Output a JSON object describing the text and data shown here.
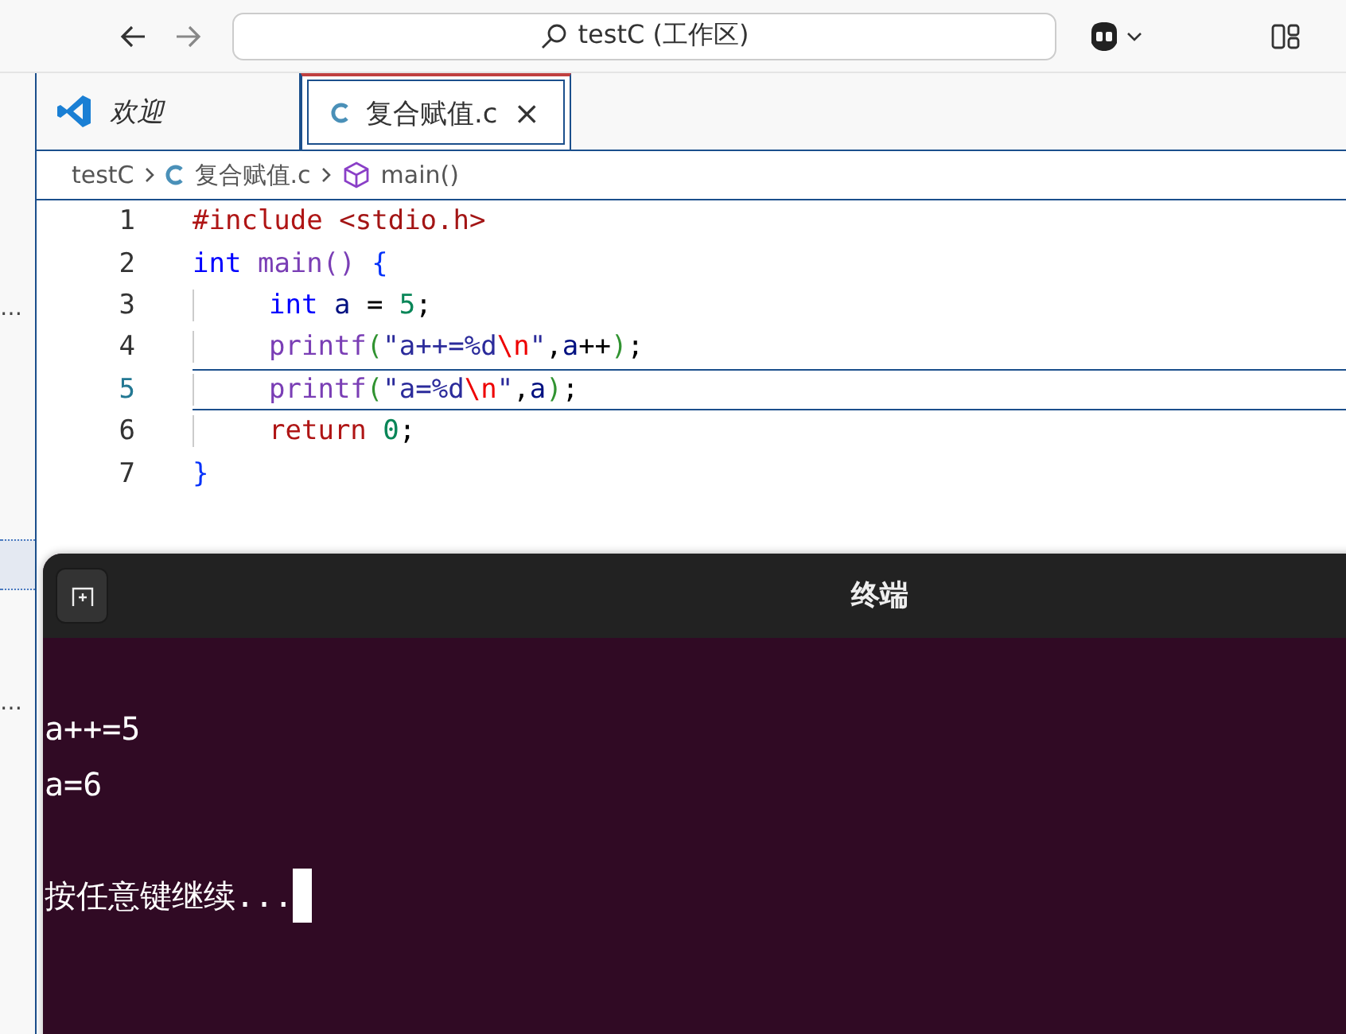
{
  "title_bar": {
    "search": "testC (工作区)"
  },
  "sidebar": {
    "items": [
      "…",
      "…"
    ]
  },
  "tabs": [
    {
      "label": "欢迎",
      "kind": "welcome",
      "selected": false
    },
    {
      "label": "复合赋值.c",
      "kind": "c",
      "selected": true,
      "close": "×"
    }
  ],
  "breadcrumb": [
    {
      "label": "testC",
      "kind": "folder"
    },
    {
      "label": "复合赋值.c",
      "kind": "c"
    },
    {
      "label": "main()",
      "kind": "symbol"
    }
  ],
  "code": [
    {
      "number": "1",
      "current": false,
      "indent": false,
      "tokens": [
        {
          "text": "#include",
          "kind": "preprocessor"
        },
        {
          "text": " <stdio.h>",
          "kind": "include"
        }
      ]
    },
    {
      "number": "2",
      "current": false,
      "indent": false,
      "tokens": [
        {
          "text": "int",
          "kind": "keyword"
        },
        {
          "text": " main",
          "kind": "function"
        },
        {
          "text": "()",
          "kind": "bracket2"
        },
        {
          "text": " {",
          "kind": "bracket1"
        }
      ]
    },
    {
      "number": "3",
      "current": false,
      "indent": true,
      "tokens": [
        {
          "text": "int",
          "kind": "keyword"
        },
        {
          "text": " a",
          "kind": "variable"
        },
        {
          "text": " = ",
          "kind": "plain"
        },
        {
          "text": "5",
          "kind": "number"
        },
        {
          "text": ";",
          "kind": "plain"
        }
      ]
    },
    {
      "number": "4",
      "current": false,
      "indent": true,
      "tokens": [
        {
          "text": "printf",
          "kind": "function"
        },
        {
          "text": "(",
          "kind": "bracket3"
        },
        {
          "text": "\"a++=%d",
          "kind": "string"
        },
        {
          "text": "\\n",
          "kind": "escape"
        },
        {
          "text": "\"",
          "kind": "string"
        },
        {
          "text": ",",
          "kind": "plain"
        },
        {
          "text": "a",
          "kind": "variable"
        },
        {
          "text": "++",
          "kind": "plain"
        },
        {
          "text": ")",
          "kind": "bracket3"
        },
        {
          "text": ";",
          "kind": "plain"
        }
      ]
    },
    {
      "number": "5",
      "current": true,
      "indent": true,
      "tokens": [
        {
          "text": "printf",
          "kind": "function"
        },
        {
          "text": "(",
          "kind": "bracket3"
        },
        {
          "text": "\"a=%d",
          "kind": "string"
        },
        {
          "text": "\\n",
          "kind": "escape"
        },
        {
          "text": "\"",
          "kind": "string"
        },
        {
          "text": ",",
          "kind": "plain"
        },
        {
          "text": "a",
          "kind": "variable"
        },
        {
          "text": ")",
          "kind": "bracket3"
        },
        {
          "text": ";",
          "kind": "plain"
        }
      ]
    },
    {
      "number": "6",
      "current": false,
      "indent": true,
      "tokens": [
        {
          "text": "return",
          "kind": "control"
        },
        {
          "text": " 0",
          "kind": "number"
        },
        {
          "text": ";",
          "kind": "plain"
        }
      ]
    },
    {
      "number": "7",
      "current": false,
      "indent": false,
      "tokens": [
        {
          "text": "}",
          "kind": "bracket1"
        }
      ]
    }
  ],
  "terminal": {
    "title": "终端",
    "output": [
      "a++=5",
      "a=6"
    ],
    "prompt": "按任意键继续...",
    "cursor": true
  }
}
